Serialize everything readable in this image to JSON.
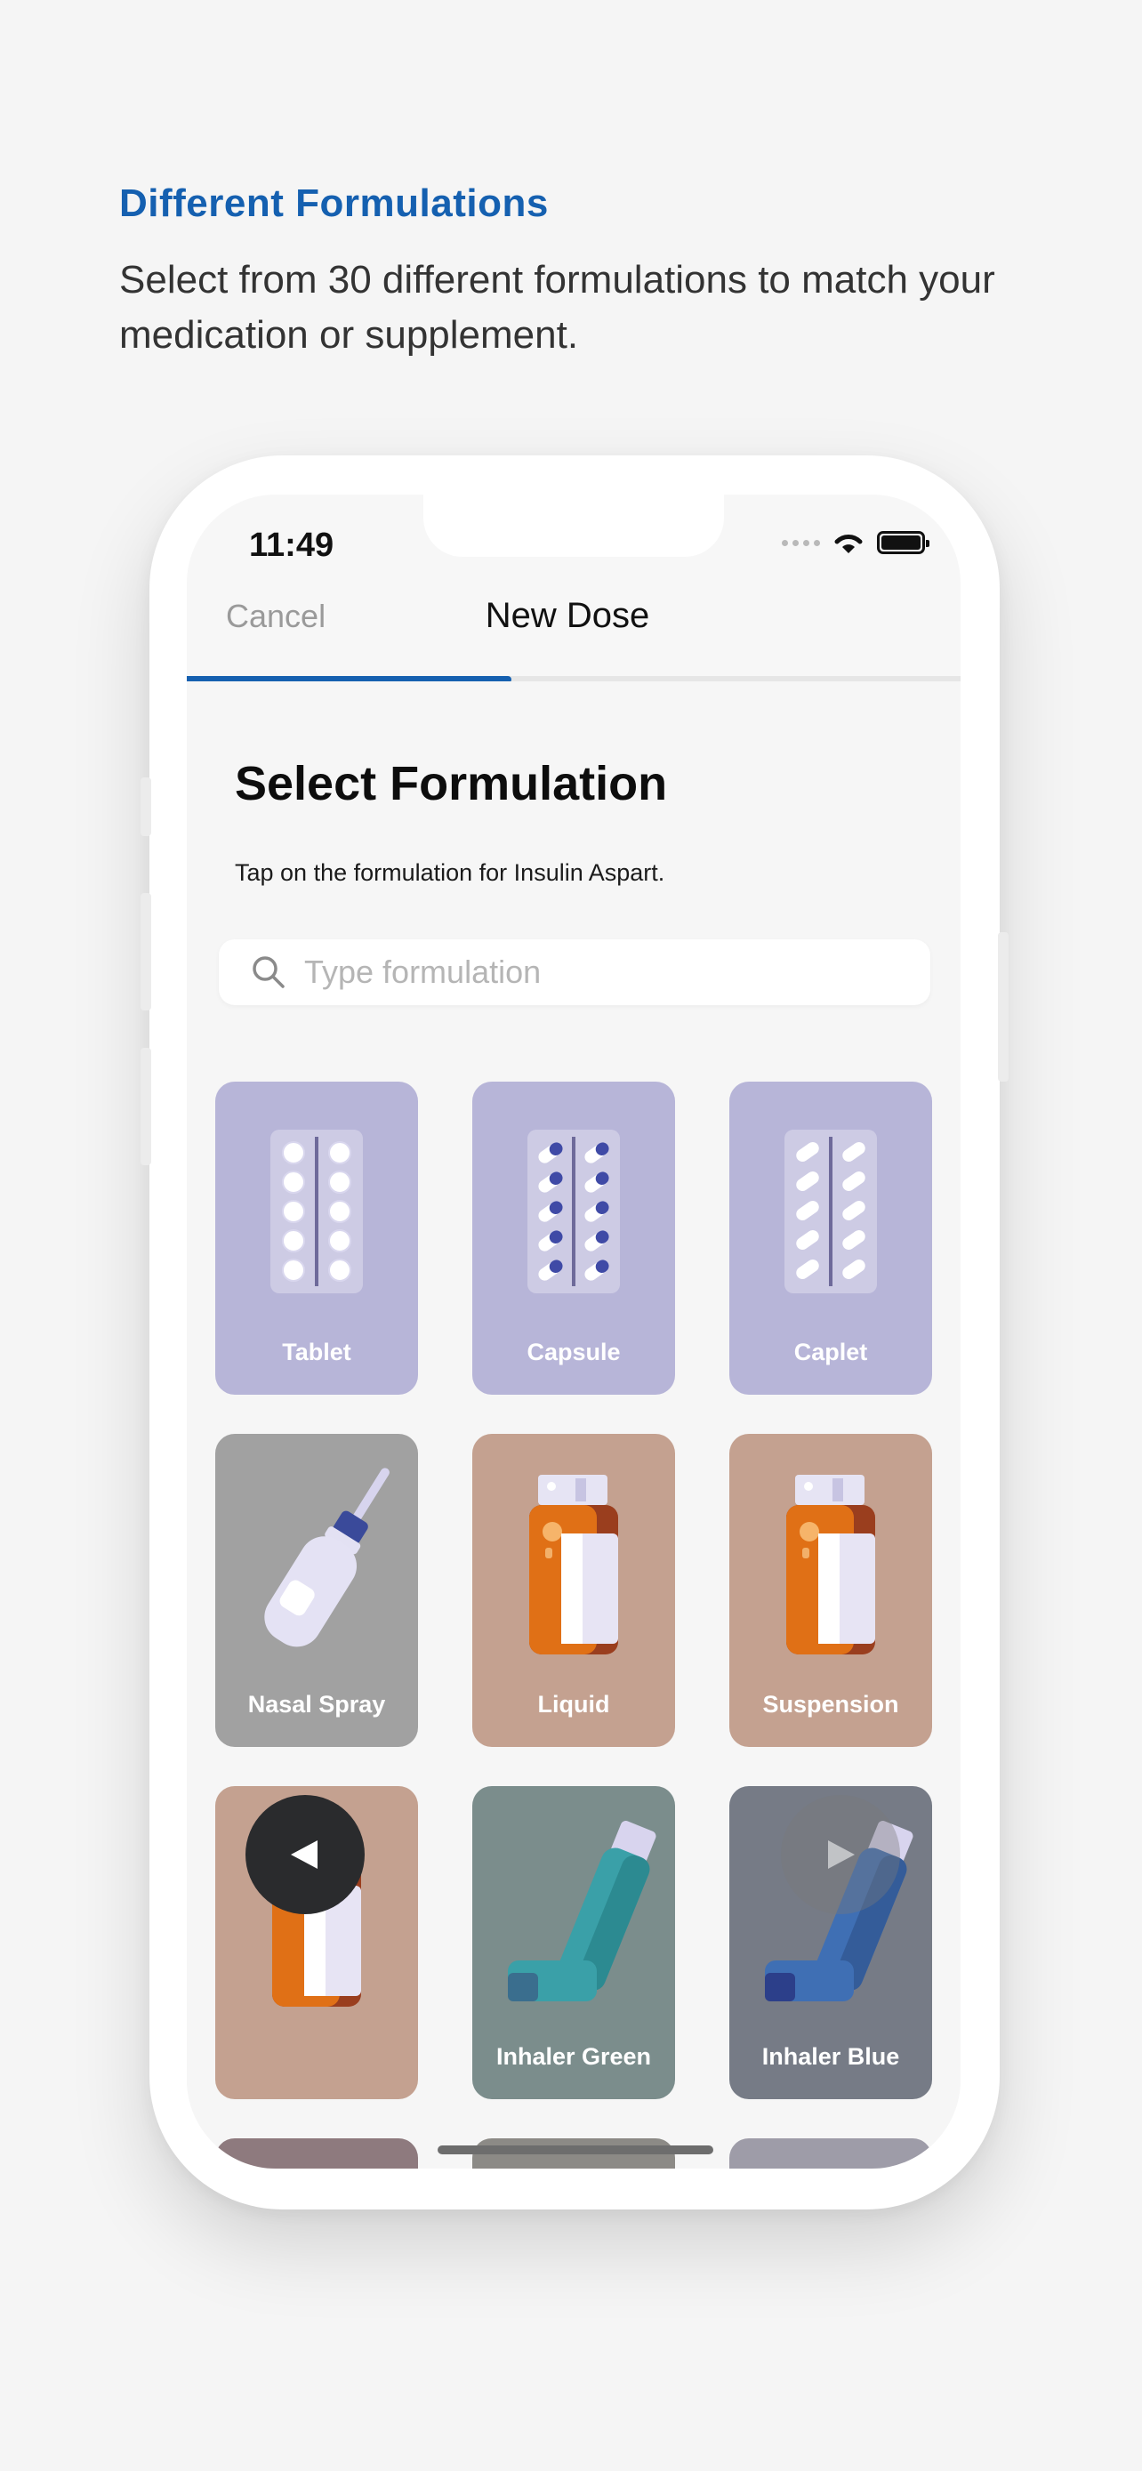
{
  "promo": {
    "title": "Different Formulations",
    "subtitle": "Select from 30 different formulations to match your medication or supplement."
  },
  "status_bar": {
    "time": "11:49"
  },
  "nav": {
    "cancel_label": "Cancel",
    "title": "New Dose",
    "progress": 0.42
  },
  "page": {
    "heading": "Select Formulation",
    "instruction": "Tap on the formulation for Insulin Aspart."
  },
  "search": {
    "placeholder": "Type formulation",
    "value": ""
  },
  "formulations": [
    {
      "label": "Tablet",
      "color": "#b7b5d8",
      "icon": "tablet-blister-icon"
    },
    {
      "label": "Capsule",
      "color": "#b7b5d8",
      "icon": "capsule-blister-icon"
    },
    {
      "label": "Caplet",
      "color": "#b7b5d8",
      "icon": "caplet-blister-icon"
    },
    {
      "label": "Nasal Spray",
      "color": "#a1a1a1",
      "icon": "nasal-spray-icon"
    },
    {
      "label": "Liquid",
      "color": "#c4a190",
      "icon": "liquid-bottle-icon"
    },
    {
      "label": "Suspension",
      "color": "#c4a190",
      "icon": "suspension-bottle-icon"
    },
    {
      "label": "",
      "color": "#c4a190",
      "icon": "bottle-icon"
    },
    {
      "label": "Inhaler Green",
      "color": "#7b8d8c",
      "icon": "inhaler-green-icon"
    },
    {
      "label": "Inhaler Blue",
      "color": "#767b86",
      "icon": "inhaler-blue-icon"
    }
  ],
  "controls": {
    "prev_icon": "triangle-left-icon",
    "next_icon": "triangle-right-icon"
  }
}
